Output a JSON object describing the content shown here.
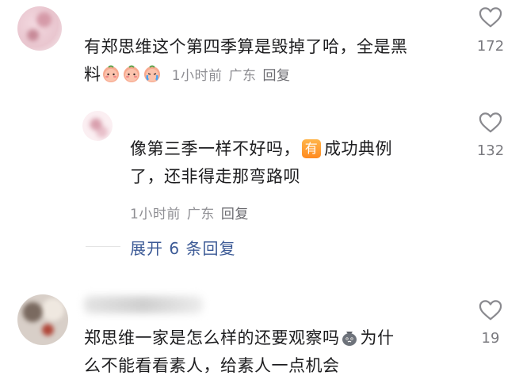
{
  "comments": [
    {
      "text_line1": "有郑思维这个第四季算是毁掉了哈，全是黑",
      "text_line2": "料",
      "emojis": [
        "peach-face-icon",
        "peach-face-icon",
        "peach-crying-icon"
      ],
      "time": "1小时前",
      "location": "广东",
      "reply_label": "回复",
      "likes": "172"
    },
    {
      "text_line1_a": "像第三季一样不好吗，",
      "badge_char": "有",
      "text_line1_b": "成功典例",
      "text_line2": "了，还非得走那弯路呗",
      "time": "1小时前",
      "location": "广东",
      "reply_label": "回复",
      "likes": "132",
      "expand_label": "展开 6 条回复"
    },
    {
      "text_line1_a": "郑思维一家是怎么样的还要观察吗",
      "emoji": "money-bag-face-icon",
      "text_line1_b": "为什",
      "text_line2": "么不能看看素人，给素人一点机会",
      "likes": "19"
    }
  ],
  "colors": {
    "text": "#1d1d1f",
    "meta": "#8e8e93",
    "link": "#3c5a96",
    "badge": "#ff9a2e"
  }
}
